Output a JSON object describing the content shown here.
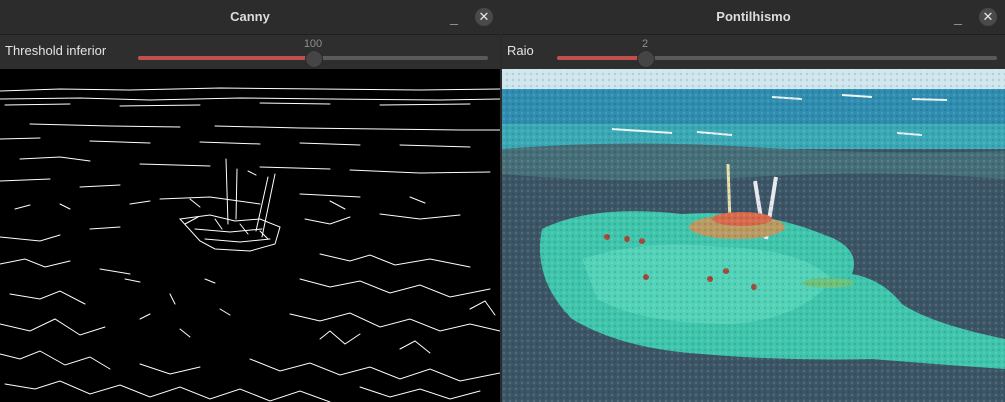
{
  "windows": {
    "canny": {
      "title": "Canny",
      "minimize": "_",
      "close": "✕",
      "slider": {
        "label": "Threshold inferior",
        "value": "100",
        "fraction": 0.5
      }
    },
    "pontilhismo": {
      "title": "Pontilhismo",
      "minimize": "_",
      "close": "✕",
      "slider": {
        "label": "Raio",
        "value": "2",
        "fraction": 0.2
      }
    }
  },
  "colors": {
    "accent": "#c0504d",
    "edge": "#ffffff",
    "sky": "#cfe6ef",
    "sea_deep": "#2f8db0",
    "reef": "#3b5566",
    "lagoon": "#3fc5ac"
  }
}
